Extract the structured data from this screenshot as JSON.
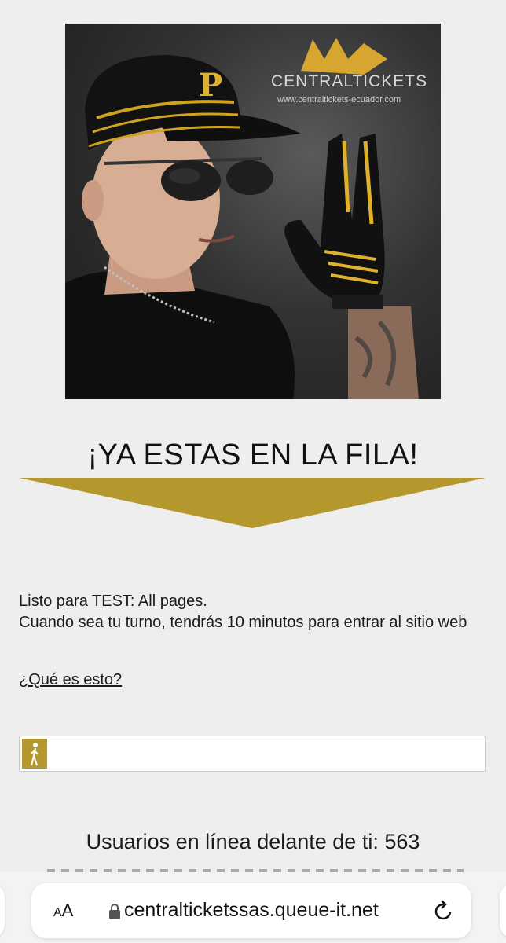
{
  "brand": {
    "name": "CENTRALTICKETS",
    "url_text": "www.centraltickets-ecuador.com"
  },
  "headline": "¡YA ESTAS EN LA FILA!",
  "info": {
    "line1": "Listo para TEST: All pages.",
    "line2": "Cuando sea tu turno, tendrás 10 minutos para entrar al sitio web"
  },
  "help_link": "¿Qué es esto?",
  "queue": {
    "label": "Usuarios en línea delante de ti:",
    "count": "563"
  },
  "browser": {
    "text_size_label_small": "A",
    "text_size_label_large": "A",
    "address": "centralticketssas.queue-it.net"
  },
  "colors": {
    "accent_gold": "#b5982d",
    "background": "#efeeee"
  },
  "icons": {
    "lock": "lock-icon",
    "reload": "reload-icon",
    "walker": "person-walking-icon"
  }
}
